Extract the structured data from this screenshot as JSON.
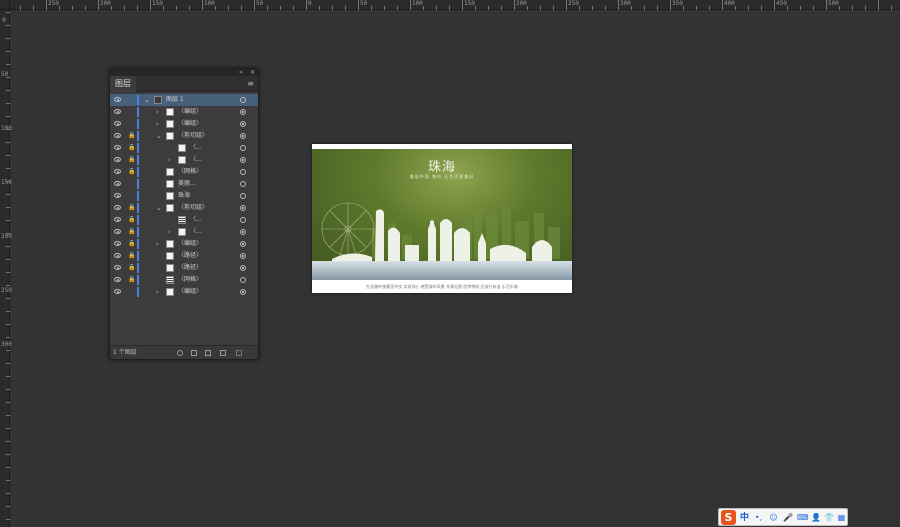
{
  "ruler": {
    "top_labels": [
      "250",
      "200",
      "150",
      "100",
      "50",
      "0",
      "50",
      "100",
      "150",
      "200",
      "250",
      "300",
      "350",
      "400",
      "450",
      "500"
    ],
    "left_labels": [
      "0",
      "50",
      "100",
      "150",
      "200",
      "250",
      "300"
    ]
  },
  "layers_panel": {
    "tab_label": "图层",
    "collapse_glyph": "»",
    "close_glyph": "✕",
    "menu_glyph": "≡",
    "footer_label": "1 个图层",
    "rows": [
      {
        "label": "图层 1",
        "selected": true,
        "locked": false,
        "expander": "v",
        "indent": 0,
        "thumb": "dark",
        "target": "empty"
      },
      {
        "label": "〈编组〉",
        "selected": false,
        "locked": false,
        "expander": ">",
        "indent": 1,
        "thumb": "white",
        "target": "filled"
      },
      {
        "label": "〈编组〉",
        "selected": false,
        "locked": false,
        "expander": ">",
        "indent": 1,
        "thumb": "white",
        "target": "filled"
      },
      {
        "label": "〈剪切组〉",
        "selected": false,
        "locked": true,
        "expander": "v",
        "indent": 1,
        "thumb": "white",
        "target": "filled"
      },
      {
        "label": "〈...",
        "selected": false,
        "locked": false,
        "dimlock": true,
        "expander": "",
        "indent": 2,
        "thumb": "white",
        "target": "empty"
      },
      {
        "label": "〈...",
        "selected": false,
        "locked": false,
        "dimlock": true,
        "expander": ">",
        "indent": 2,
        "thumb": "white",
        "target": "filled"
      },
      {
        "label": "〈网格〉",
        "selected": false,
        "locked": true,
        "expander": "",
        "indent": 1,
        "thumb": "white",
        "target": "empty"
      },
      {
        "label": "美丽...",
        "selected": false,
        "locked": false,
        "expander": "",
        "indent": 1,
        "thumb": "white",
        "target": "empty"
      },
      {
        "label": "珠海",
        "selected": false,
        "locked": false,
        "expander": "",
        "indent": 1,
        "thumb": "white",
        "target": "empty"
      },
      {
        "label": "〈剪切组〉",
        "selected": false,
        "locked": true,
        "expander": "v",
        "indent": 1,
        "thumb": "white",
        "target": "filled"
      },
      {
        "label": "〈...",
        "selected": false,
        "locked": false,
        "dimlock": true,
        "expander": "",
        "indent": 2,
        "thumb": "lines",
        "target": "empty"
      },
      {
        "label": "〈...",
        "selected": false,
        "locked": false,
        "dimlock": true,
        "expander": ">",
        "indent": 2,
        "thumb": "white",
        "target": "filled"
      },
      {
        "label": "〈编组〉",
        "selected": false,
        "locked": true,
        "expander": ">",
        "indent": 1,
        "thumb": "white",
        "target": "filled"
      },
      {
        "label": "〈路径〉",
        "selected": false,
        "locked": true,
        "expander": "",
        "indent": 1,
        "thumb": "white",
        "target": "filled"
      },
      {
        "label": "〈路径〉",
        "selected": false,
        "locked": true,
        "expander": "",
        "indent": 1,
        "thumb": "white",
        "target": "filled"
      },
      {
        "label": "〈网格〉",
        "selected": false,
        "locked": true,
        "expander": "",
        "indent": 1,
        "thumb": "lines",
        "target": "empty"
      },
      {
        "label": "〈编组〉",
        "selected": false,
        "locked": false,
        "expander": ">",
        "indent": 1,
        "thumb": "white",
        "target": "filled"
      }
    ]
  },
  "artboard": {
    "title": "珠海",
    "subtitle": "美丽中国 城市 让生活更美好",
    "caption": "在浩瀚的夜幕里寻找 实现你心 感受城市风景 充满无限 愿梦想成 还该行有温 乐活乐城"
  },
  "ime": {
    "logo": "S",
    "lang": "中",
    "icons": [
      "•,",
      "☺",
      "🎤",
      "⌨",
      "👤",
      "👕",
      "▦"
    ]
  }
}
